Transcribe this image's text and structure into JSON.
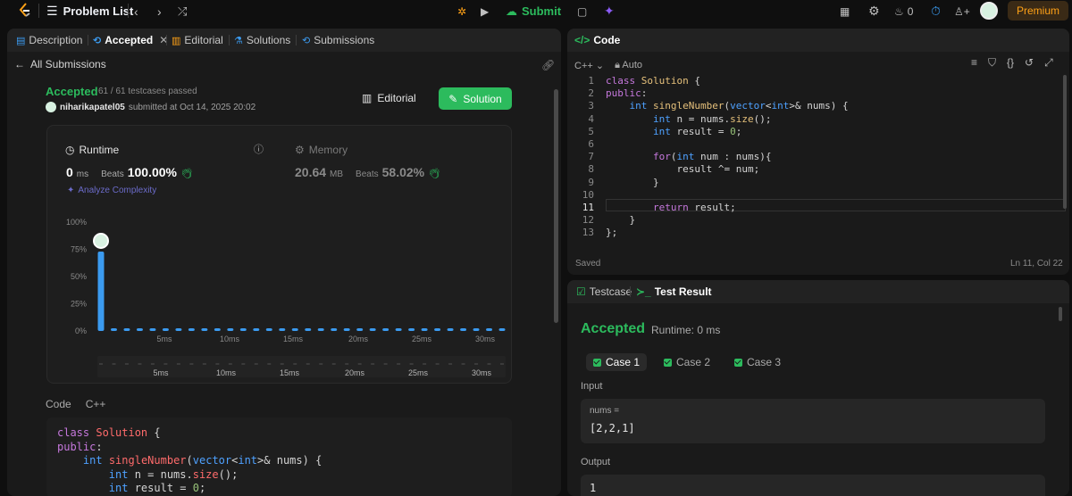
{
  "topbar": {
    "problem_list": "Problem List",
    "submit": "Submit",
    "streak": "0",
    "premium": "Premium"
  },
  "left_tabs": [
    {
      "label": "Description"
    },
    {
      "label": "Accepted"
    },
    {
      "label": "Editorial"
    },
    {
      "label": "Solutions"
    },
    {
      "label": "Submissions"
    }
  ],
  "submission": {
    "back": "All Submissions",
    "status": "Accepted",
    "testcases": "61 / 61 testcases passed",
    "user": "niharikapatel05",
    "submitted": "submitted at Oct 14, 2025 20:02",
    "editorial_btn": "Editorial",
    "solution_btn": "Solution",
    "runtime_label": "Runtime",
    "runtime_value": "0",
    "runtime_unit": "ms",
    "beats_label": "Beats",
    "runtime_beats": "100.00%",
    "memory_label": "Memory",
    "memory_value": "20.64",
    "memory_unit": "MB",
    "memory_beats": "58.02%",
    "analyze": "Analyze Complexity"
  },
  "chart_data": {
    "type": "bar",
    "y_ticks": [
      "100%",
      "75%",
      "50%",
      "25%",
      "0%"
    ],
    "ylim": [
      0,
      100
    ],
    "x_ticks": [
      "5ms",
      "10ms",
      "15ms",
      "20ms",
      "25ms",
      "30ms"
    ],
    "values": [
      73,
      1,
      1,
      1,
      1,
      1,
      1,
      1,
      1,
      1,
      1,
      1,
      1,
      1,
      1,
      1,
      1,
      1,
      1,
      1,
      1,
      1,
      1,
      1,
      1,
      1,
      1,
      1,
      1,
      1,
      1,
      1
    ],
    "color": "#3b9bf0"
  },
  "code_section": {
    "label": "Code",
    "lang": "C++",
    "lines": [
      "class Solution {",
      "public:",
      "    int singleNumber(vector<int>& nums) {",
      "        int n = nums.size();",
      "        int result = 0;"
    ]
  },
  "editor": {
    "title": "Code",
    "lang": "C++",
    "mode": "Auto",
    "lines": [
      "class Solution {",
      "public:",
      "    int singleNumber(vector<int>& nums) {",
      "        int n = nums.size();",
      "        int result = 0;",
      "",
      "        for(int num : nums){",
      "            result ^= num;",
      "        }",
      "",
      "        return result;",
      "    }",
      "};"
    ],
    "line_numbers": [
      "1",
      "2",
      "3",
      "4",
      "5",
      "6",
      "7",
      "8",
      "9",
      "10",
      "11",
      "12",
      "13"
    ],
    "status": "Saved",
    "position": "Ln 11, Col 22"
  },
  "result": {
    "tab_testcase": "Testcase",
    "tab_result": "Test Result",
    "status": "Accepted",
    "runtime": "Runtime: 0 ms",
    "cases": [
      "Case 1",
      "Case 2",
      "Case 3"
    ],
    "input_label": "Input",
    "input_var": "nums =",
    "input_value": "[2,2,1]",
    "output_label": "Output",
    "output_value": "1"
  },
  "colors": {
    "accent_green": "#2cbb5d",
    "premium": "#ffa116",
    "bar": "#3b9bf0"
  }
}
